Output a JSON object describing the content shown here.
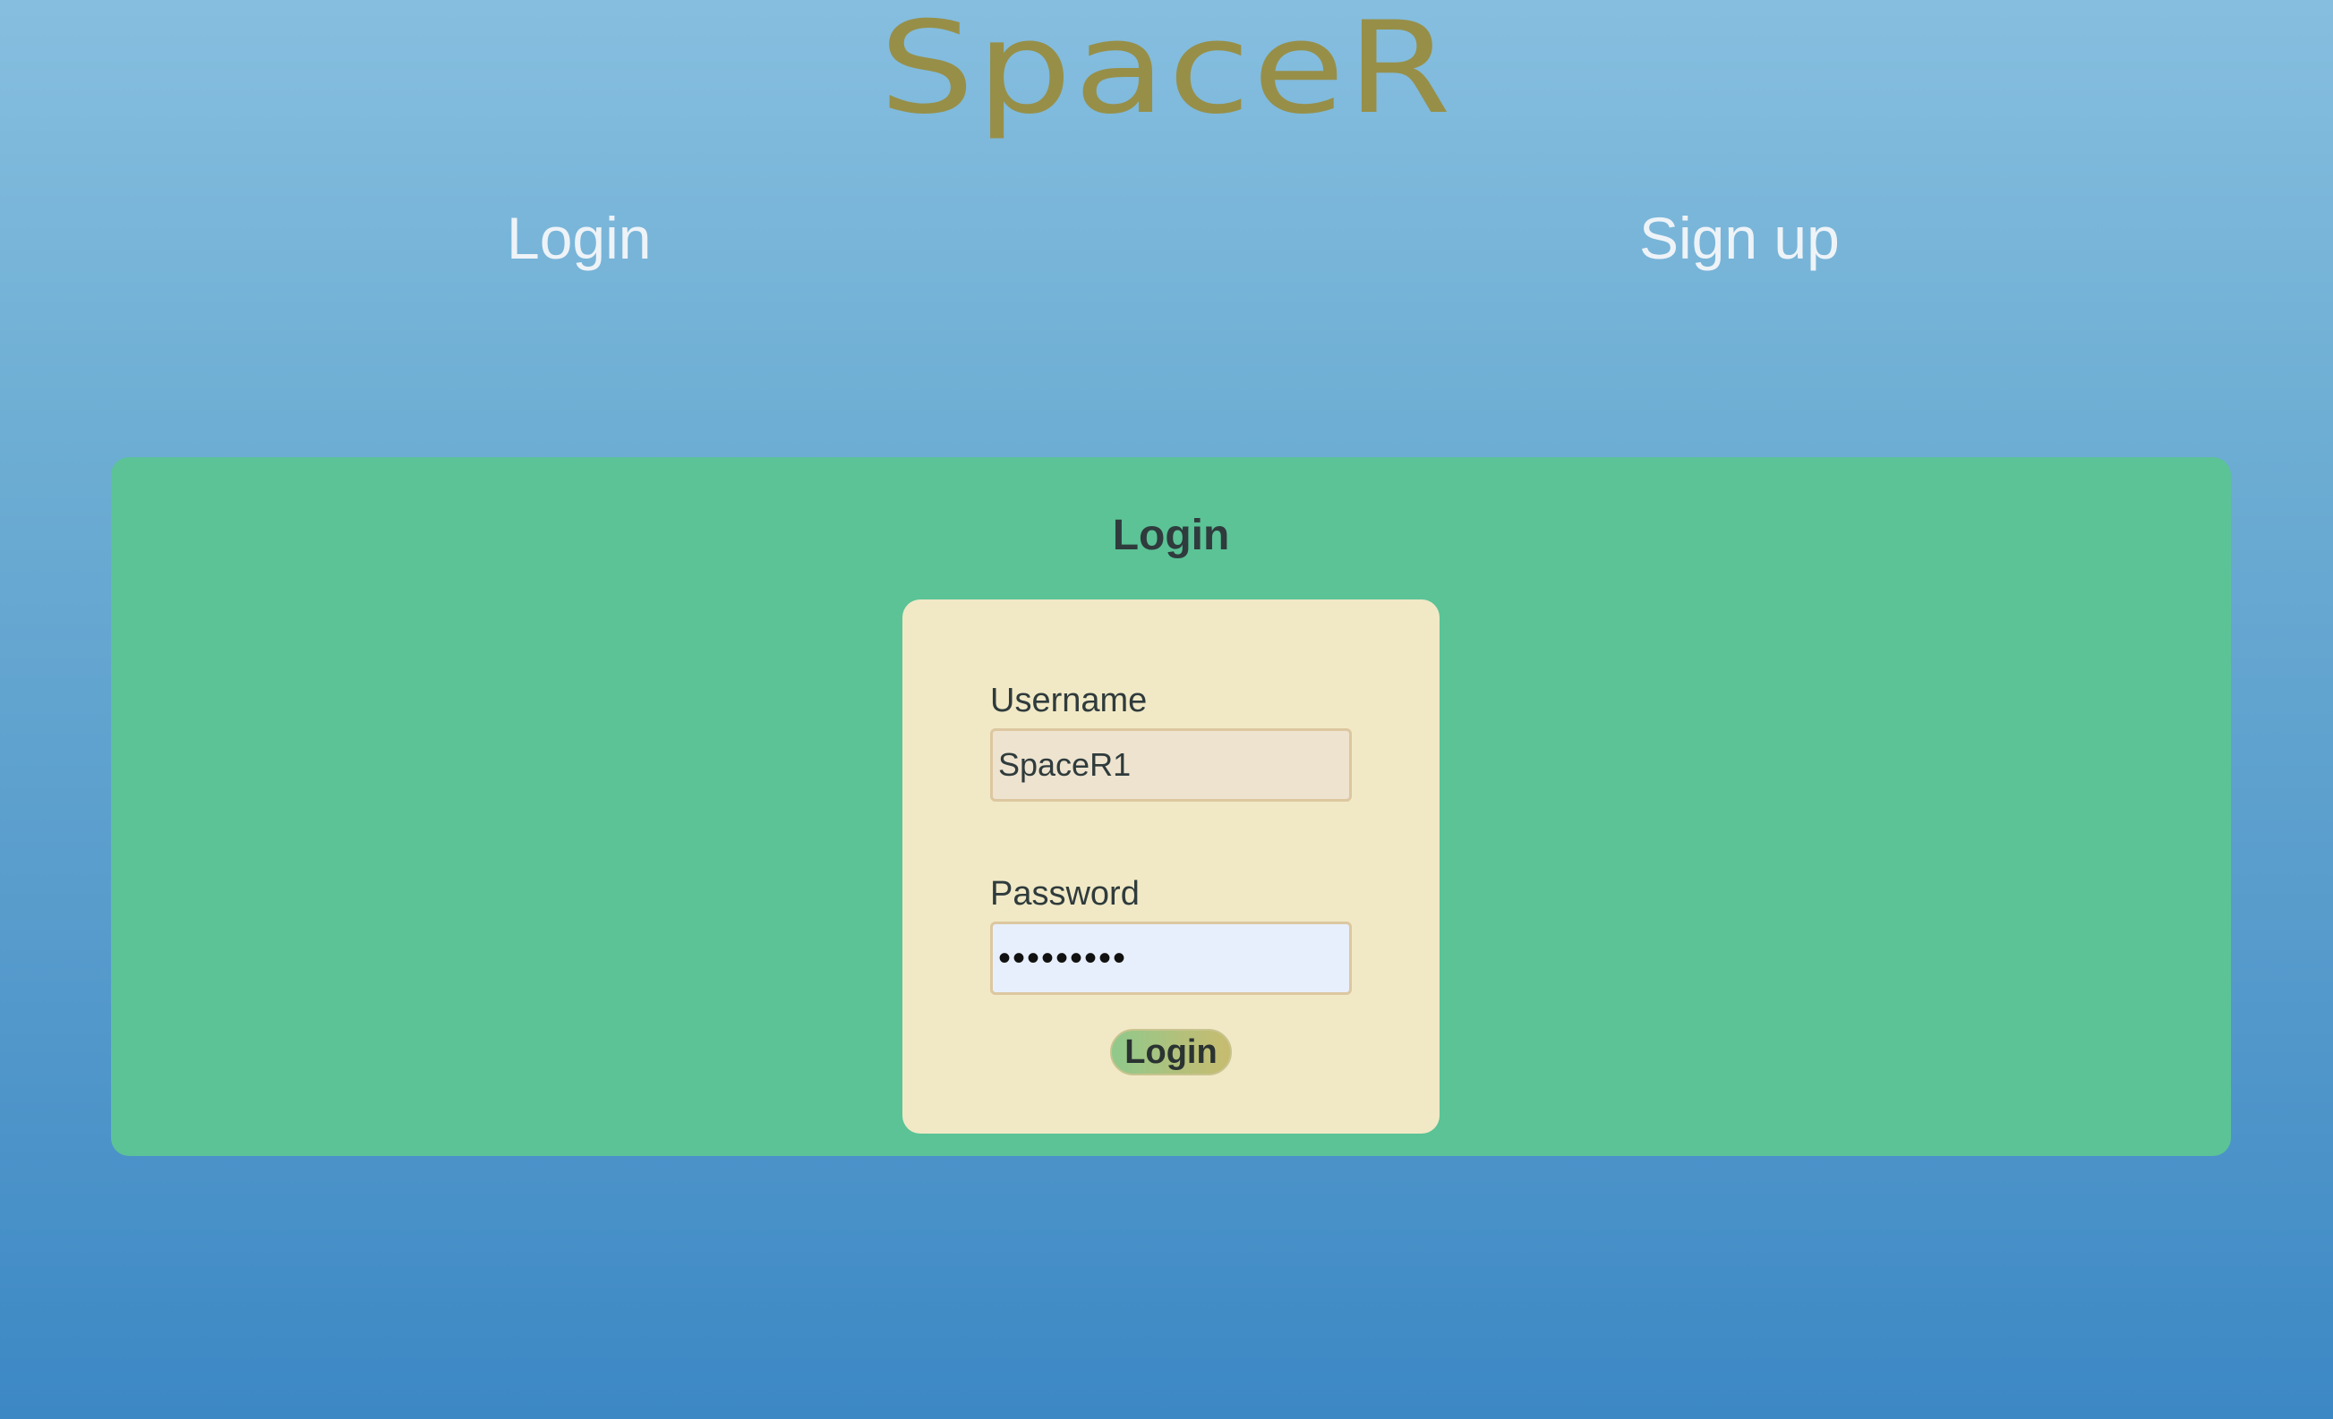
{
  "logo": {
    "text": "SpaceR",
    "color": "#978f48"
  },
  "nav": {
    "login_label": "Login",
    "signup_label": "Sign up"
  },
  "login_panel": {
    "title": "Login",
    "username_label": "Username",
    "username_value": "SpaceR1",
    "password_label": "Password",
    "password_value": "•••••••••",
    "submit_label": "Login"
  },
  "colors": {
    "panel": "#5bc396",
    "card": "#f1e9c6",
    "background_top": "#86bedf",
    "background_bottom": "#3c88c5"
  }
}
